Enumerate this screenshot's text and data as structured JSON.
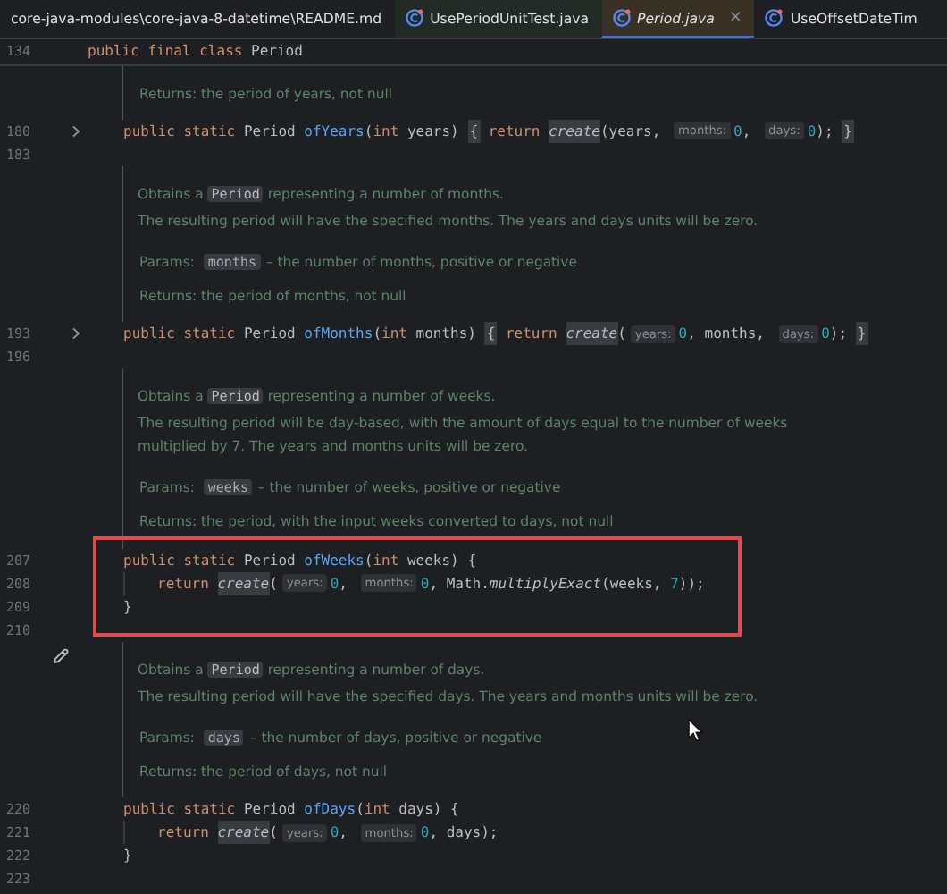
{
  "tabs": [
    {
      "label": "core-java-modules\\core-java-8-datetime\\README.md",
      "kind": "markdown",
      "selected": false,
      "color": "#1e1f22"
    },
    {
      "label": "UsePeriodUnitTest.java",
      "kind": "java",
      "selected": false,
      "color": "#212a24"
    },
    {
      "label": "Period.java",
      "kind": "java",
      "selected": true,
      "color": "#3a3125",
      "close": "×"
    },
    {
      "label": "UseOffsetDateTim",
      "kind": "java",
      "selected": false,
      "color": "#1e1f22"
    }
  ],
  "sticky_header": {
    "number": "134",
    "tokens": [
      {
        "kind": "keyword",
        "text": "public final class "
      },
      {
        "kind": "plain",
        "text": "Period"
      }
    ]
  },
  "rows": [
    {
      "kind": "doc",
      "hovered": false,
      "paragraphs": [
        {
          "kind": "returns",
          "parts": [
            {
              "kind": "text",
              "text": "Returns: the period of years, not null"
            }
          ]
        }
      ]
    },
    {
      "kind": "member_line",
      "number": "180",
      "folded": true,
      "tokens": [
        {
          "kind": "keyword",
          "text": "public static "
        },
        {
          "kind": "plain",
          "text": "Period "
        },
        {
          "kind": "method",
          "text": "ofYears"
        },
        {
          "kind": "plain",
          "text": "("
        },
        {
          "kind": "keyword",
          "text": "int"
        },
        {
          "kind": "plain",
          "text": " years) "
        },
        {
          "kind": "brace",
          "text": "{"
        },
        {
          "kind": "keyword",
          "text": " return "
        },
        {
          "kind": "call",
          "text": "create"
        },
        {
          "kind": "plain",
          "text": "(years, "
        },
        {
          "kind": "hint",
          "text": "months:"
        },
        {
          "kind": "number",
          "text": "0"
        },
        {
          "kind": "plain",
          "text": ", "
        },
        {
          "kind": "hint",
          "text": "days:"
        },
        {
          "kind": "number",
          "text": "0"
        },
        {
          "kind": "plain",
          "text": "); "
        },
        {
          "kind": "brace",
          "text": "}"
        }
      ]
    },
    {
      "kind": "blank_line",
      "number": "183",
      "folded": false
    },
    {
      "kind": "doc",
      "hovered": false,
      "paragraphs": [
        {
          "kind": "description",
          "parts": [
            {
              "kind": "text",
              "text": "Obtains a "
            },
            {
              "kind": "code",
              "text": "Period"
            },
            {
              "kind": "text",
              "text": " representing a number of months."
            }
          ]
        },
        {
          "kind": "description",
          "parts": [
            {
              "kind": "text",
              "text": "The resulting period will have the specified months. The years and days units will be zero."
            }
          ]
        },
        {
          "kind": "params",
          "parts": [
            {
              "kind": "text",
              "text": "Params: "
            },
            {
              "kind": "code",
              "text": "months"
            },
            {
              "kind": "text",
              "text": " – the number of months, positive or negative"
            }
          ]
        },
        {
          "kind": "returns",
          "parts": [
            {
              "kind": "text",
              "text": "Returns: the period of months, not null"
            }
          ]
        }
      ]
    },
    {
      "kind": "member_line",
      "number": "193",
      "folded": true,
      "tokens": [
        {
          "kind": "keyword",
          "text": "public static "
        },
        {
          "kind": "plain",
          "text": "Period "
        },
        {
          "kind": "method",
          "text": "ofMonths"
        },
        {
          "kind": "plain",
          "text": "("
        },
        {
          "kind": "keyword",
          "text": "int"
        },
        {
          "kind": "plain",
          "text": " months) "
        },
        {
          "kind": "brace",
          "text": "{"
        },
        {
          "kind": "keyword",
          "text": " return "
        },
        {
          "kind": "call",
          "text": "create"
        },
        {
          "kind": "plain",
          "text": "("
        },
        {
          "kind": "hint",
          "text": "years:"
        },
        {
          "kind": "number",
          "text": "0"
        },
        {
          "kind": "plain",
          "text": ", months, "
        },
        {
          "kind": "hint",
          "text": "days:"
        },
        {
          "kind": "number",
          "text": "0"
        },
        {
          "kind": "plain",
          "text": "); "
        },
        {
          "kind": "brace",
          "text": "}"
        }
      ]
    },
    {
      "kind": "blank_line",
      "number": "196",
      "folded": false
    },
    {
      "kind": "doc",
      "hovered": false,
      "paragraphs": [
        {
          "kind": "description",
          "parts": [
            {
              "kind": "text",
              "text": "Obtains a "
            },
            {
              "kind": "code",
              "text": "Period"
            },
            {
              "kind": "text",
              "text": " representing a number of weeks."
            }
          ]
        },
        {
          "kind": "description",
          "parts": [
            {
              "kind": "text",
              "text": "The resulting period will be day-based, with the amount of days equal to the number of weeks multiplied by 7. The years and months units will be zero."
            }
          ]
        },
        {
          "kind": "params",
          "parts": [
            {
              "kind": "text",
              "text": "Params: "
            },
            {
              "kind": "code",
              "text": "weeks"
            },
            {
              "kind": "text",
              "text": " – the number of weeks, positive or negative"
            }
          ]
        },
        {
          "kind": "returns",
          "parts": [
            {
              "kind": "text",
              "text": "Returns: the period, with the input weeks converted to days, not null"
            }
          ]
        }
      ]
    },
    {
      "kind": "highlight",
      "lines": [
        {
          "kind": "member_line",
          "number": "207",
          "tokens": [
            {
              "kind": "keyword",
              "text": "public static "
            },
            {
              "kind": "plain",
              "text": "Period "
            },
            {
              "kind": "method",
              "text": "ofWeeks"
            },
            {
              "kind": "plain",
              "text": "("
            },
            {
              "kind": "keyword",
              "text": "int"
            },
            {
              "kind": "plain",
              "text": " weeks) {"
            }
          ]
        },
        {
          "kind": "body_line",
          "number": "208",
          "tokens": [
            {
              "kind": "keyword",
              "text": "return "
            },
            {
              "kind": "call",
              "text": "create"
            },
            {
              "kind": "plain",
              "text": "("
            },
            {
              "kind": "hint",
              "text": "years:"
            },
            {
              "kind": "number",
              "text": "0"
            },
            {
              "kind": "plain",
              "text": ", "
            },
            {
              "kind": "hint",
              "text": "months:"
            },
            {
              "kind": "number",
              "text": "0"
            },
            {
              "kind": "plain",
              "text": ", Math."
            },
            {
              "kind": "static_call",
              "text": "multiplyExact"
            },
            {
              "kind": "plain",
              "text": "(weeks, "
            },
            {
              "kind": "number",
              "text": "7"
            },
            {
              "kind": "plain",
              "text": "));"
            }
          ]
        },
        {
          "kind": "member_line",
          "number": "209",
          "tokens": [
            {
              "kind": "plain",
              "text": "}"
            }
          ]
        },
        {
          "kind": "blank_line",
          "number": "210"
        }
      ]
    },
    {
      "kind": "doc",
      "hovered": true,
      "paragraphs": [
        {
          "kind": "description",
          "parts": [
            {
              "kind": "text",
              "text": "Obtains a "
            },
            {
              "kind": "code",
              "text": "Period"
            },
            {
              "kind": "text",
              "text": " representing a number of days."
            }
          ]
        },
        {
          "kind": "description",
          "parts": [
            {
              "kind": "text",
              "text": "The resulting period will have the specified days. The years and months units will be zero."
            }
          ]
        },
        {
          "kind": "params",
          "parts": [
            {
              "kind": "text",
              "text": "Params: "
            },
            {
              "kind": "code",
              "text": "days"
            },
            {
              "kind": "text",
              "text": " – the number of days, positive or negative"
            }
          ]
        },
        {
          "kind": "returns",
          "parts": [
            {
              "kind": "text",
              "text": "Returns: the period of days, not null"
            }
          ]
        }
      ]
    },
    {
      "kind": "member_line",
      "number": "220",
      "folded": false,
      "tokens": [
        {
          "kind": "keyword",
          "text": "public static "
        },
        {
          "kind": "plain",
          "text": "Period "
        },
        {
          "kind": "method",
          "text": "ofDays"
        },
        {
          "kind": "plain",
          "text": "("
        },
        {
          "kind": "keyword",
          "text": "int"
        },
        {
          "kind": "plain",
          "text": " days) {"
        }
      ]
    },
    {
      "kind": "body_line",
      "number": "221",
      "folded": false,
      "tokens": [
        {
          "kind": "keyword",
          "text": "return "
        },
        {
          "kind": "call",
          "text": "create"
        },
        {
          "kind": "plain",
          "text": "("
        },
        {
          "kind": "hint",
          "text": "years:"
        },
        {
          "kind": "number",
          "text": "0"
        },
        {
          "kind": "plain",
          "text": ", "
        },
        {
          "kind": "hint",
          "text": "months:"
        },
        {
          "kind": "number",
          "text": "0"
        },
        {
          "kind": "plain",
          "text": ", days);"
        }
      ]
    },
    {
      "kind": "member_line",
      "number": "222",
      "folded": false,
      "tokens": [
        {
          "kind": "plain",
          "text": "}"
        }
      ]
    },
    {
      "kind": "blank_line",
      "number": "223",
      "folded": false
    }
  ]
}
